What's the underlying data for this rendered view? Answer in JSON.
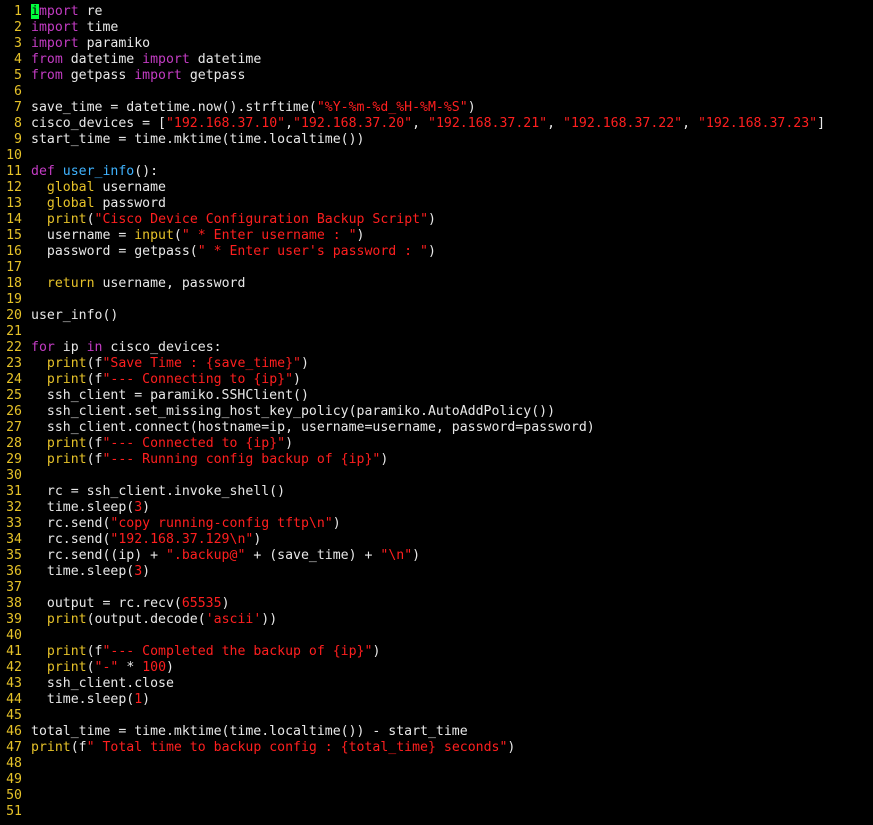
{
  "editor": {
    "lines": [
      {
        "n": "1",
        "t": [
          [
            "cursor",
            "i"
          ],
          [
            "kw",
            "mport"
          ],
          [
            "tx",
            " re"
          ]
        ]
      },
      {
        "n": "2",
        "t": [
          [
            "kw",
            "import"
          ],
          [
            "tx",
            " time"
          ]
        ]
      },
      {
        "n": "3",
        "t": [
          [
            "kw",
            "import"
          ],
          [
            "tx",
            " paramiko"
          ]
        ]
      },
      {
        "n": "4",
        "t": [
          [
            "kw",
            "from"
          ],
          [
            "tx",
            " datetime "
          ],
          [
            "kw",
            "import"
          ],
          [
            "tx",
            " datetime"
          ]
        ]
      },
      {
        "n": "5",
        "t": [
          [
            "kw",
            "from"
          ],
          [
            "tx",
            " getpass "
          ],
          [
            "kw",
            "import"
          ],
          [
            "tx",
            " getpass"
          ]
        ]
      },
      {
        "n": "6",
        "t": []
      },
      {
        "n": "7",
        "t": [
          [
            "tx",
            "save_time = datetime.now().strftime("
          ],
          [
            "str",
            "\"%Y-%m-%d_%H-%M-%S\""
          ],
          [
            "tx",
            ")"
          ]
        ]
      },
      {
        "n": "8",
        "t": [
          [
            "tx",
            "cisco_devices = ["
          ],
          [
            "str",
            "\"192.168.37.10\""
          ],
          [
            "tx",
            ","
          ],
          [
            "str",
            "\"192.168.37.20\""
          ],
          [
            "tx",
            ", "
          ],
          [
            "str",
            "\"192.168.37.21\""
          ],
          [
            "tx",
            ", "
          ],
          [
            "str",
            "\"192.168.37.22\""
          ],
          [
            "tx",
            ", "
          ],
          [
            "str",
            "\"192.168.37.23\""
          ],
          [
            "tx",
            "]"
          ]
        ]
      },
      {
        "n": "9",
        "t": [
          [
            "tx",
            "start_time = time.mktime(time.localtime())"
          ]
        ]
      },
      {
        "n": "10",
        "t": []
      },
      {
        "n": "11",
        "t": [
          [
            "kw",
            "def"
          ],
          [
            "tx",
            " "
          ],
          [
            "fn",
            "user_info"
          ],
          [
            "tx",
            "():"
          ]
        ]
      },
      {
        "n": "12",
        "t": [
          [
            "tx",
            "  "
          ],
          [
            "bi",
            "global"
          ],
          [
            "tx",
            " username"
          ]
        ]
      },
      {
        "n": "13",
        "t": [
          [
            "tx",
            "  "
          ],
          [
            "bi",
            "global"
          ],
          [
            "tx",
            " password"
          ]
        ]
      },
      {
        "n": "14",
        "t": [
          [
            "tx",
            "  "
          ],
          [
            "bi",
            "print"
          ],
          [
            "tx",
            "("
          ],
          [
            "str",
            "\"Cisco Device Configuration Backup Script\""
          ],
          [
            "tx",
            ")"
          ]
        ]
      },
      {
        "n": "15",
        "t": [
          [
            "tx",
            "  username = "
          ],
          [
            "bi",
            "input"
          ],
          [
            "tx",
            "("
          ],
          [
            "str",
            "\" * Enter username : \""
          ],
          [
            "tx",
            ")"
          ]
        ]
      },
      {
        "n": "16",
        "t": [
          [
            "tx",
            "  password = getpass("
          ],
          [
            "str",
            "\" * Enter user's password : \""
          ],
          [
            "tx",
            ")"
          ]
        ]
      },
      {
        "n": "17",
        "t": []
      },
      {
        "n": "18",
        "t": [
          [
            "tx",
            "  "
          ],
          [
            "bi",
            "return"
          ],
          [
            "tx",
            " username, password"
          ]
        ]
      },
      {
        "n": "19",
        "t": []
      },
      {
        "n": "20",
        "t": [
          [
            "tx",
            "user_info()"
          ]
        ]
      },
      {
        "n": "21",
        "t": []
      },
      {
        "n": "22",
        "t": [
          [
            "kw",
            "for"
          ],
          [
            "tx",
            " ip "
          ],
          [
            "kw",
            "in"
          ],
          [
            "tx",
            " cisco_devices:"
          ]
        ]
      },
      {
        "n": "23",
        "t": [
          [
            "tx",
            "  "
          ],
          [
            "bi",
            "print"
          ],
          [
            "tx",
            "(f"
          ],
          [
            "str",
            "\"Save Time : {save_time}\""
          ],
          [
            "tx",
            ")"
          ]
        ]
      },
      {
        "n": "24",
        "t": [
          [
            "tx",
            "  "
          ],
          [
            "bi",
            "print"
          ],
          [
            "tx",
            "(f"
          ],
          [
            "str",
            "\"--- Connecting to {ip}\""
          ],
          [
            "tx",
            ")"
          ]
        ]
      },
      {
        "n": "25",
        "t": [
          [
            "tx",
            "  ssh_client = paramiko.SSHClient()"
          ]
        ]
      },
      {
        "n": "26",
        "t": [
          [
            "tx",
            "  ssh_client.set_missing_host_key_policy(paramiko.AutoAddPolicy())"
          ]
        ]
      },
      {
        "n": "27",
        "t": [
          [
            "tx",
            "  ssh_client.connect(hostname=ip, username=username, password=password)"
          ]
        ]
      },
      {
        "n": "28",
        "t": [
          [
            "tx",
            "  "
          ],
          [
            "bi",
            "print"
          ],
          [
            "tx",
            "(f"
          ],
          [
            "str",
            "\"--- Connected to {ip}\""
          ],
          [
            "tx",
            ")"
          ]
        ]
      },
      {
        "n": "29",
        "t": [
          [
            "tx",
            "  "
          ],
          [
            "bi",
            "print"
          ],
          [
            "tx",
            "(f"
          ],
          [
            "str",
            "\"--- Running config backup of {ip}\""
          ],
          [
            "tx",
            ")"
          ]
        ]
      },
      {
        "n": "30",
        "t": []
      },
      {
        "n": "31",
        "t": [
          [
            "tx",
            "  rc = ssh_client.invoke_shell()"
          ]
        ]
      },
      {
        "n": "32",
        "t": [
          [
            "tx",
            "  time.sleep("
          ],
          [
            "num",
            "3"
          ],
          [
            "tx",
            ")"
          ]
        ]
      },
      {
        "n": "33",
        "t": [
          [
            "tx",
            "  rc.send("
          ],
          [
            "str",
            "\"copy running-config tftp\\n\""
          ],
          [
            "tx",
            ")"
          ]
        ]
      },
      {
        "n": "34",
        "t": [
          [
            "tx",
            "  rc.send("
          ],
          [
            "str",
            "\"192.168.37.129\\n\""
          ],
          [
            "tx",
            ")"
          ]
        ]
      },
      {
        "n": "35",
        "t": [
          [
            "tx",
            "  rc.send((ip) + "
          ],
          [
            "str",
            "\".backup@\""
          ],
          [
            "tx",
            " + (save_time) + "
          ],
          [
            "str",
            "\"\\n\""
          ],
          [
            "tx",
            ")"
          ]
        ]
      },
      {
        "n": "36",
        "t": [
          [
            "tx",
            "  time.sleep("
          ],
          [
            "num",
            "3"
          ],
          [
            "tx",
            ")"
          ]
        ]
      },
      {
        "n": "37",
        "t": []
      },
      {
        "n": "38",
        "t": [
          [
            "tx",
            "  output = rc.recv("
          ],
          [
            "num",
            "65535"
          ],
          [
            "tx",
            ")"
          ]
        ]
      },
      {
        "n": "39",
        "t": [
          [
            "tx",
            "  "
          ],
          [
            "bi",
            "print"
          ],
          [
            "tx",
            "(output.decode("
          ],
          [
            "str",
            "'ascii'"
          ],
          [
            "tx",
            "))"
          ]
        ]
      },
      {
        "n": "40",
        "t": []
      },
      {
        "n": "41",
        "t": [
          [
            "tx",
            "  "
          ],
          [
            "bi",
            "print"
          ],
          [
            "tx",
            "(f"
          ],
          [
            "str",
            "\"--- Completed the backup of {ip}\""
          ],
          [
            "tx",
            ")"
          ]
        ]
      },
      {
        "n": "42",
        "t": [
          [
            "tx",
            "  "
          ],
          [
            "bi",
            "print"
          ],
          [
            "tx",
            "("
          ],
          [
            "str",
            "\"-\""
          ],
          [
            "tx",
            " * "
          ],
          [
            "num",
            "100"
          ],
          [
            "tx",
            ")"
          ]
        ]
      },
      {
        "n": "43",
        "t": [
          [
            "tx",
            "  ssh_client.close"
          ]
        ]
      },
      {
        "n": "44",
        "t": [
          [
            "tx",
            "  time.sleep("
          ],
          [
            "num",
            "1"
          ],
          [
            "tx",
            ")"
          ]
        ]
      },
      {
        "n": "45",
        "t": []
      },
      {
        "n": "46",
        "t": [
          [
            "tx",
            "total_time = time.mktime(time.localtime()) - start_time"
          ]
        ]
      },
      {
        "n": "47",
        "t": [
          [
            "bi",
            "print"
          ],
          [
            "tx",
            "(f"
          ],
          [
            "str",
            "\" Total time to backup config : {total_time} seconds\""
          ],
          [
            "tx",
            ")"
          ]
        ]
      },
      {
        "n": "48",
        "t": []
      },
      {
        "n": "49",
        "t": []
      },
      {
        "n": "50",
        "t": []
      },
      {
        "n": "51",
        "t": []
      }
    ]
  },
  "colors": {
    "background": "#000000",
    "line_number": "#e6c229",
    "keyword": "#c33cc3",
    "function_name": "#3fb3ff",
    "string": "#ff1f1f",
    "builtin": "#e6c229",
    "text": "#e8e8e8",
    "cursor": "#00ff3c"
  },
  "status_line": ""
}
